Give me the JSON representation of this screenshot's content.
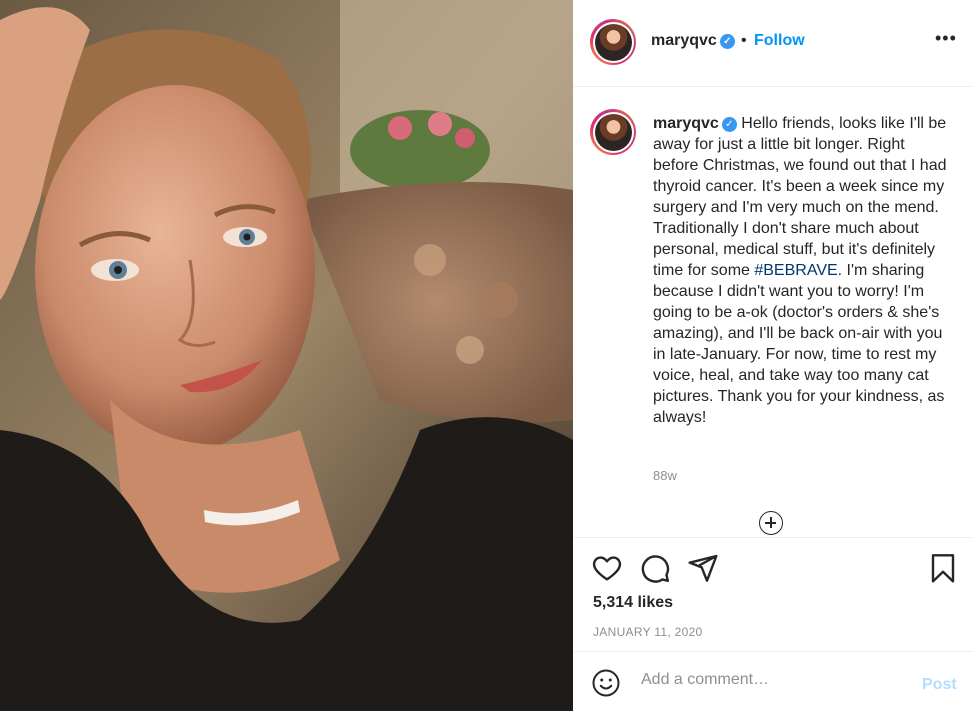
{
  "post": {
    "image_alt": "Selfie photo of a woman with a bandage on her neck"
  },
  "header": {
    "username": "maryqvc",
    "verified_badge": "✓",
    "separator": "•",
    "follow_label": "Follow",
    "more_label": "•••"
  },
  "caption": {
    "username": "maryqvc",
    "text_before_tag": "Hello friends, looks like I'll be away for just a little bit longer. Right before Christmas, we found out that I had thyroid cancer. It's been a week since my surgery and I'm very much on the mend. Traditionally I don't share much about personal, medical stuff, but it's definitely time for some ",
    "hashtag": "#BEBRAVE",
    "text_after_tag": ". I'm sharing because I didn't want you to worry! I'm going to be a-ok (doctor's orders & she's amazing), and I'll be back on-air with you in late-January. For now, time to rest my voice, heal, and take way too many cat pictures. Thank you for your kindness, as always!",
    "age": "88w"
  },
  "actions": {
    "likes": "5,314 likes",
    "date": "JANUARY 11, 2020"
  },
  "comment": {
    "placeholder": "Add a comment…",
    "post_label": "Post"
  },
  "colors": {
    "link": "#0095f6",
    "hashtag": "#00376b",
    "muted": "#8e8e8e",
    "post_disabled": "#b2dffc",
    "verified": "#3897f0"
  }
}
